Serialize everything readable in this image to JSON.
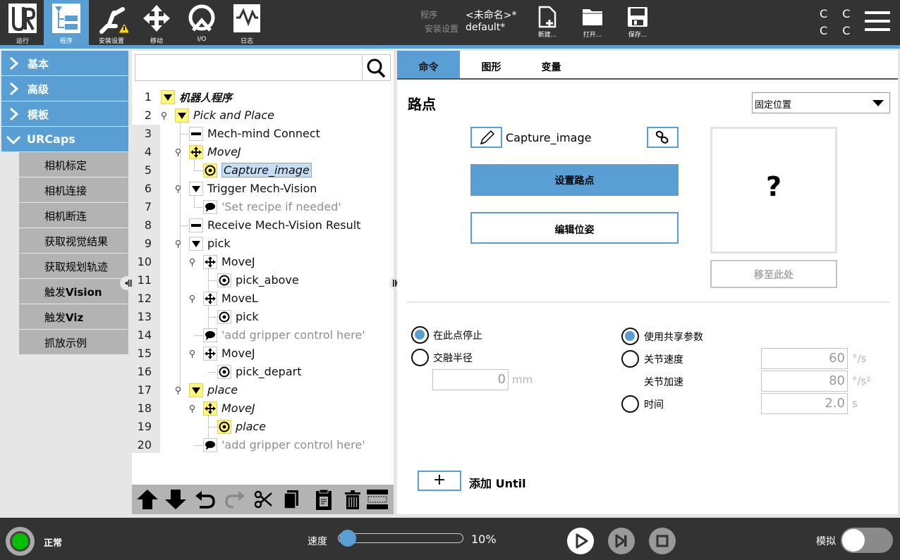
{
  "topbar": {
    "nav_tabs": [
      {
        "label": "运行",
        "icon": "ur-logo-icon",
        "active": false
      },
      {
        "label": "程序",
        "icon": "program-tree-icon",
        "active": true
      },
      {
        "label": "安装设置",
        "icon": "robot-arm-warning-icon",
        "active": false
      },
      {
        "label": "移动",
        "icon": "move-arrows-icon",
        "active": false
      },
      {
        "label": "I/O",
        "icon": "io-icon",
        "active": false
      },
      {
        "label": "日志",
        "icon": "log-chart-icon",
        "active": false
      }
    ],
    "program_label": "程序",
    "program_value": "<未命名>*",
    "installation_label": "安装设置",
    "installation_value": "default*",
    "file_buttons": [
      {
        "label": "新建...",
        "icon": "new-file-icon"
      },
      {
        "label": "打开...",
        "icon": "open-folder-icon"
      },
      {
        "label": "保存...",
        "icon": "save-disk-icon"
      }
    ],
    "cc_indicator": "C C",
    "cc_indicator2": "C C",
    "menu_icon": "hamburger-menu-icon"
  },
  "sidebar": {
    "categories": [
      {
        "label": "基本",
        "expanded": false
      },
      {
        "label": "高级",
        "expanded": false
      },
      {
        "label": "模板",
        "expanded": false
      },
      {
        "label": "URCaps",
        "expanded": true
      }
    ],
    "urcaps_items": [
      {
        "label": "相机标定",
        "bold_suffix": ""
      },
      {
        "label": "相机连接",
        "bold_suffix": ""
      },
      {
        "label": "相机断连",
        "bold_suffix": ""
      },
      {
        "label": "获取视觉结果",
        "bold_suffix": ""
      },
      {
        "label": "获取规划轨迹",
        "bold_suffix": ""
      },
      {
        "label": "触发",
        "bold_suffix": "Vision"
      },
      {
        "label": "触发",
        "bold_suffix": "Viz"
      },
      {
        "label": "抓放示例",
        "bold_suffix": ""
      }
    ]
  },
  "tree": {
    "search_placeholder": "",
    "rows": [
      {
        "num": "1",
        "text": "机器人程序",
        "icon": "expand-triangle-icon",
        "style": "bold-italic",
        "yellow": true
      },
      {
        "num": "2",
        "text": "Pick and Place",
        "icon": "expand-triangle-icon",
        "style": "italic",
        "yellow": true
      },
      {
        "num": "3",
        "text": "Mech-mind Connect",
        "icon": "urcap-node-icon",
        "style": "normal",
        "yellow": false
      },
      {
        "num": "4",
        "text": "MoveJ",
        "icon": "move-arrows-icon",
        "style": "italic",
        "yellow": true
      },
      {
        "num": "5",
        "text": "Capture_image",
        "icon": "waypoint-icon",
        "style": "italic",
        "yellow": true,
        "selected": true
      },
      {
        "num": "6",
        "text": "Trigger Mech-Vision",
        "icon": "expand-triangle-icon",
        "style": "normal",
        "yellow": false
      },
      {
        "num": "7",
        "text": "'Set recipe if needed'",
        "icon": "comment-icon",
        "style": "comment",
        "yellow": false
      },
      {
        "num": "8",
        "text": "Receive Mech-Vision Result",
        "icon": "urcap-node-icon",
        "style": "normal",
        "yellow": false
      },
      {
        "num": "9",
        "text": "pick",
        "icon": "expand-triangle-icon",
        "style": "normal",
        "yellow": false
      },
      {
        "num": "10",
        "text": "MoveJ",
        "icon": "move-arrows-icon",
        "style": "normal",
        "yellow": false
      },
      {
        "num": "11",
        "text": "pick_above",
        "icon": "waypoint-icon",
        "style": "normal",
        "yellow": false
      },
      {
        "num": "12",
        "text": "MoveL",
        "icon": "move-arrows-icon",
        "style": "normal",
        "yellow": false
      },
      {
        "num": "13",
        "text": "pick",
        "icon": "waypoint-icon",
        "style": "normal",
        "yellow": false
      },
      {
        "num": "14",
        "text": "'add gripper control here'",
        "icon": "comment-icon",
        "style": "comment",
        "yellow": false
      },
      {
        "num": "15",
        "text": "MoveJ",
        "icon": "move-arrows-icon",
        "style": "normal",
        "yellow": false
      },
      {
        "num": "16",
        "text": "pick_depart",
        "icon": "waypoint-icon",
        "style": "normal",
        "yellow": false
      },
      {
        "num": "17",
        "text": "place",
        "icon": "expand-triangle-icon",
        "style": "italic",
        "yellow": true
      },
      {
        "num": "18",
        "text": "MoveJ",
        "icon": "move-arrows-icon",
        "style": "italic",
        "yellow": true
      },
      {
        "num": "19",
        "text": "place",
        "icon": "waypoint-icon",
        "style": "italic",
        "yellow": true
      },
      {
        "num": "20",
        "text": "'add gripper control here'",
        "icon": "comment-icon",
        "style": "comment",
        "yellow": false
      }
    ],
    "toolbar": [
      "move-up-icon",
      "move-down-icon",
      "undo-icon",
      "redo-icon",
      "cut-icon",
      "copy-icon",
      "paste-icon",
      "delete-icon",
      "suppress-icon"
    ]
  },
  "command": {
    "tabs": [
      {
        "label": "命令",
        "active": true
      },
      {
        "label": "图形",
        "active": false
      },
      {
        "label": "变量",
        "active": false
      }
    ],
    "title": "路点",
    "position_type": "固定位置",
    "waypoint_name": "Capture_image",
    "set_waypoint_label": "设置路点",
    "edit_pose_label": "编辑位姿",
    "preview_symbol": "?",
    "move_here_label": "移至此处",
    "stop_at_point_label": "在此点停止",
    "blend_radius_label": "交融半径",
    "blend_radius_value": "0",
    "blend_radius_unit": "mm",
    "use_shared_label": "使用共享参数",
    "joint_speed_label": "关节速度",
    "joint_speed_value": "60",
    "joint_speed_unit": "°/s",
    "joint_accel_label": "关节加速",
    "joint_accel_value": "80",
    "joint_accel_unit": "°/s²",
    "time_label": "时间",
    "time_value": "2.0",
    "time_unit": "s",
    "add_until_symbol": "+",
    "add_until_label": "添加 Until",
    "stop_at_point_selected": true,
    "use_shared_selected": true
  },
  "bottombar": {
    "status_text": "正常",
    "status_color": "#00c000",
    "speed_label": "速度",
    "speed_value": "10%",
    "speed_fraction": 0.1,
    "simulation_label": "模拟",
    "simulation_on": false
  },
  "colors": {
    "accent": "#5a9fd4",
    "bar_bg": "#333333",
    "highlight_yellow": "#fff67a"
  }
}
